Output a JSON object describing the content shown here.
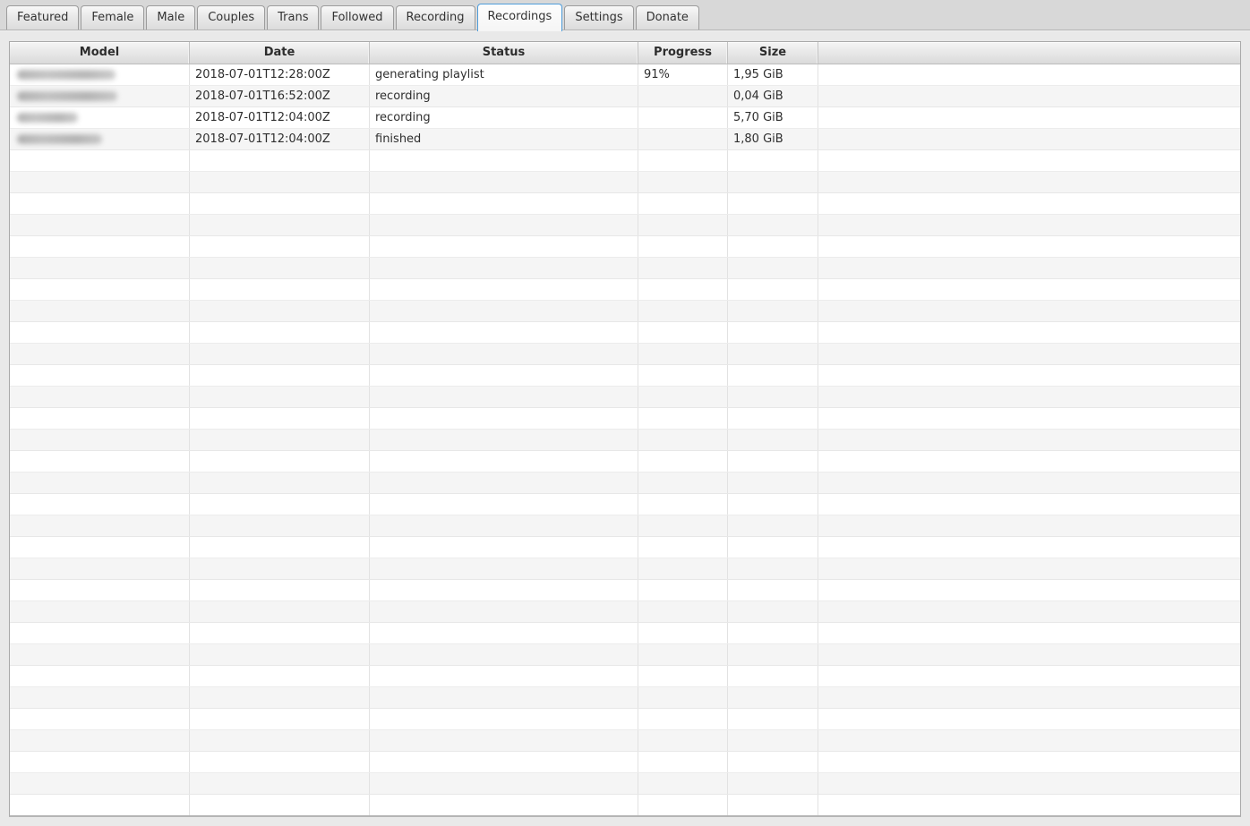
{
  "active_tab": "Recordings",
  "tabs": [
    {
      "label": "Featured"
    },
    {
      "label": "Female"
    },
    {
      "label": "Male"
    },
    {
      "label": "Couples"
    },
    {
      "label": "Trans"
    },
    {
      "label": "Followed"
    },
    {
      "label": "Recording"
    },
    {
      "label": "Recordings"
    },
    {
      "label": "Settings"
    },
    {
      "label": "Donate"
    }
  ],
  "table": {
    "columns": [
      {
        "id": "model",
        "label": "Model"
      },
      {
        "id": "date",
        "label": "Date"
      },
      {
        "id": "status",
        "label": "Status"
      },
      {
        "id": "progress",
        "label": "Progress"
      },
      {
        "id": "size",
        "label": "Size"
      },
      {
        "id": "filler",
        "label": ""
      }
    ],
    "rows": [
      {
        "model_redacted": true,
        "model_blur_width": 110,
        "date": "2018-07-01T12:28:00Z",
        "status": "generating playlist",
        "progress": "91%",
        "size": "1,95 GiB"
      },
      {
        "model_redacted": true,
        "model_blur_width": 112,
        "date": "2018-07-01T16:52:00Z",
        "status": "recording",
        "progress": "",
        "size": "0,04 GiB"
      },
      {
        "model_redacted": true,
        "model_blur_width": 68,
        "date": "2018-07-01T12:04:00Z",
        "status": "recording",
        "progress": "",
        "size": "5,70 GiB"
      },
      {
        "model_redacted": true,
        "model_blur_width": 95,
        "date": "2018-07-01T12:04:00Z",
        "status": "finished",
        "progress": "",
        "size": "1,80 GiB"
      }
    ],
    "empty_row_count": 31
  },
  "colors": {
    "active_tab_border": "#4f9ddb",
    "row_stripe": "#f5f5f5",
    "header_text": "#2d2d2d",
    "body_text": "#2e2e2e",
    "window_background": "#e9e9e9"
  }
}
